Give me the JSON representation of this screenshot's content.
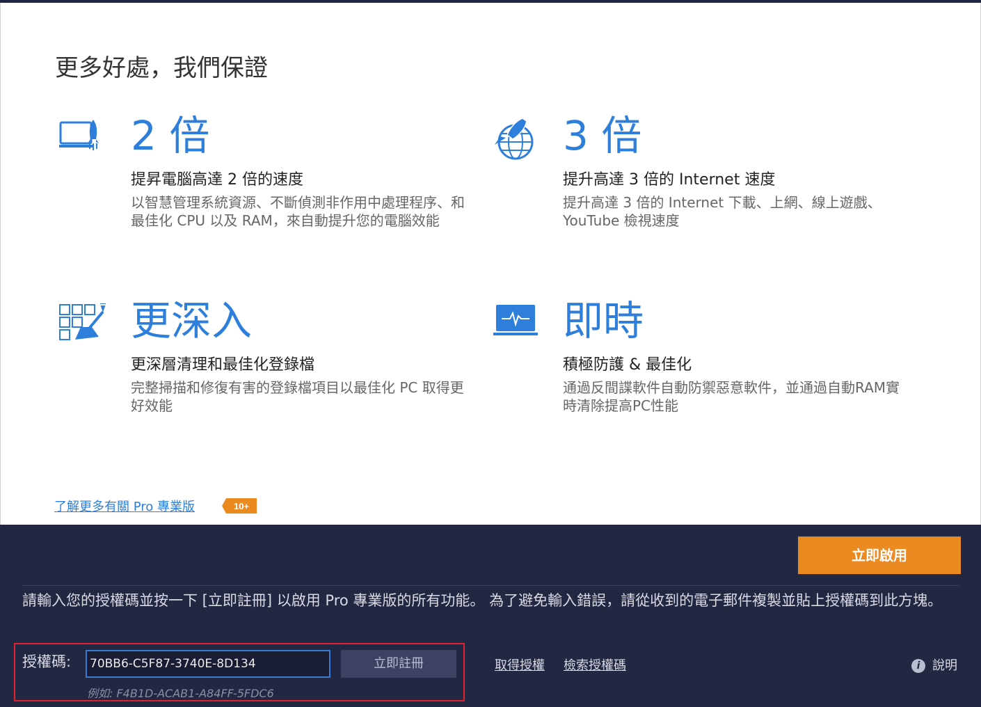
{
  "headline": "更多好處，我們保證",
  "features": [
    {
      "icon": "computer-rocket-icon",
      "big": "2 倍",
      "sub": "提昇電腦高達 2 倍的速度",
      "desc": "以智慧管理系統資源、不斷偵測非作用中處理程序、和最佳化 CPU 以及 RAM，來自動提升您的電腦效能"
    },
    {
      "icon": "rocket-globe-icon",
      "big": "3 倍",
      "sub": "提升高達 3 倍的 Internet 速度",
      "desc": "提升高達 3 倍的 Internet 下載、上網、線上遊戲、YouTube 檢視速度"
    },
    {
      "icon": "registry-broom-icon",
      "big": "更深入",
      "sub": "更深層清理和最佳化登錄檔",
      "desc": "完整掃描和修復有害的登錄檔項目以最佳化 PC 取得更好效能"
    },
    {
      "icon": "monitor-pulse-icon",
      "big": "即時",
      "sub": "積極防護 & 最佳化",
      "desc": "通過反間諜軟件自動防禦惡意軟件，並通過自動RAM實時清除提高PC性能"
    }
  ],
  "learn_more": "了解更多有關 Pro 專業版",
  "badge": "10+",
  "activate_label": "立即啟用",
  "instruction": "請輸入您的授權碼並按一下 [立即註冊] 以啟用 Pro 專業版的所有功能。 為了避免輸入錯誤，請從收到的電子郵件複製並貼上授權碼到此方塊。",
  "license": {
    "label": "授權碼:",
    "value": "70BB6-C5F87-3740E-8D134",
    "register_label": "立即註冊",
    "example": "例如: F4B1D-ACAB1-A84FF-5FDC6"
  },
  "links": {
    "get_license": "取得授權",
    "retrieve_license": "檢索授權碼"
  },
  "help_label": "說明",
  "colors": {
    "accent_blue": "#2e7fdb",
    "orange": "#ec8a22",
    "dark_panel": "#222742",
    "alert_red": "#e0232b"
  }
}
